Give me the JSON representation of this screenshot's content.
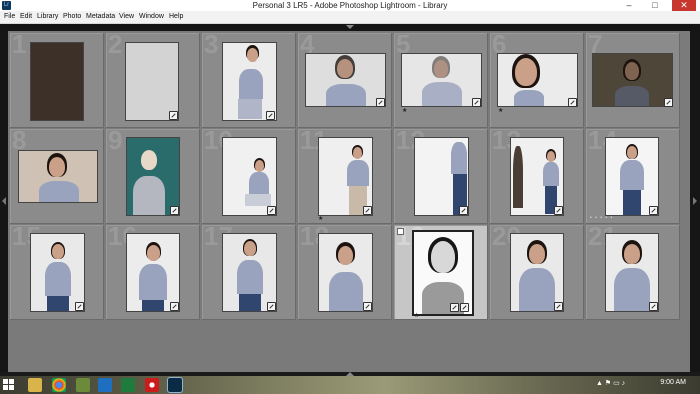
{
  "window": {
    "title": "Personal 3 LR5 - Adobe Photoshop Lightroom - Library",
    "app_icon": "Lr",
    "controls": {
      "minimize": "–",
      "maximize": "□",
      "close": "✕"
    }
  },
  "menu": {
    "items": [
      "File",
      "Edit",
      "Library",
      "Photo",
      "Metadata",
      "View",
      "Window",
      "Help"
    ]
  },
  "grid": {
    "cells": [
      {
        "number": "1"
      },
      {
        "number": "2"
      },
      {
        "number": "3"
      },
      {
        "number": "4"
      },
      {
        "number": "5"
      },
      {
        "number": "6"
      },
      {
        "number": "7"
      },
      {
        "number": "8"
      },
      {
        "number": "9"
      },
      {
        "number": "10"
      },
      {
        "number": "11"
      },
      {
        "number": "12"
      },
      {
        "number": "13"
      },
      {
        "number": "14"
      },
      {
        "number": "15"
      },
      {
        "number": "16"
      },
      {
        "number": "17"
      },
      {
        "number": "18"
      },
      {
        "number": "19"
      },
      {
        "number": "20"
      },
      {
        "number": "21"
      }
    ],
    "star": "★",
    "rating_dots": "• • • • •"
  },
  "taskbar": {
    "clock": "9:00 AM",
    "apps": [
      "file-explorer",
      "chrome",
      "lightroom-alt",
      "outlook",
      "excel",
      "opera",
      "lightroom"
    ]
  },
  "colors": {
    "accent": "#7b7b7b",
    "selected": "#c6c6c6",
    "close": "#c8372d"
  }
}
